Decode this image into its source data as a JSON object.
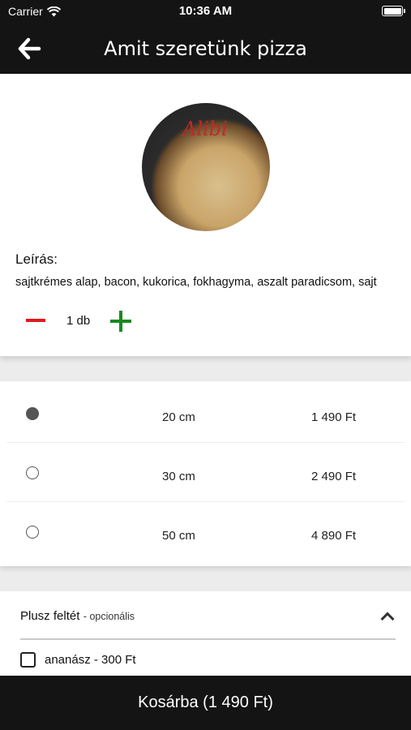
{
  "status_bar": {
    "carrier": "Carrier",
    "time": "10:36 AM"
  },
  "nav": {
    "title": "Amit szeretünk pizza",
    "back_icon": "arrow-left-icon"
  },
  "product": {
    "image_logo_text": "Alibi",
    "description_label": "Leírás:",
    "description": "sajtkrémes alap, bacon, kukorica, fokhagyma, aszalt paradicsom, sajt",
    "quantity": "1 db"
  },
  "sizes": [
    {
      "size": "20 cm",
      "price": "1 490 Ft",
      "selected": true
    },
    {
      "size": "30 cm",
      "price": "2 490 Ft",
      "selected": false
    },
    {
      "size": "50 cm",
      "price": "4 890 Ft",
      "selected": false
    }
  ],
  "extras": {
    "label": "Plusz feltét",
    "sublabel": "- opcionális",
    "items": [
      {
        "label": "ananász - 300 Ft",
        "checked": false
      }
    ]
  },
  "cart": {
    "label": "Kosárba (1 490 Ft)"
  },
  "colors": {
    "bar": "#141414",
    "minus": "#e0191f",
    "plus": "#178a1e"
  }
}
